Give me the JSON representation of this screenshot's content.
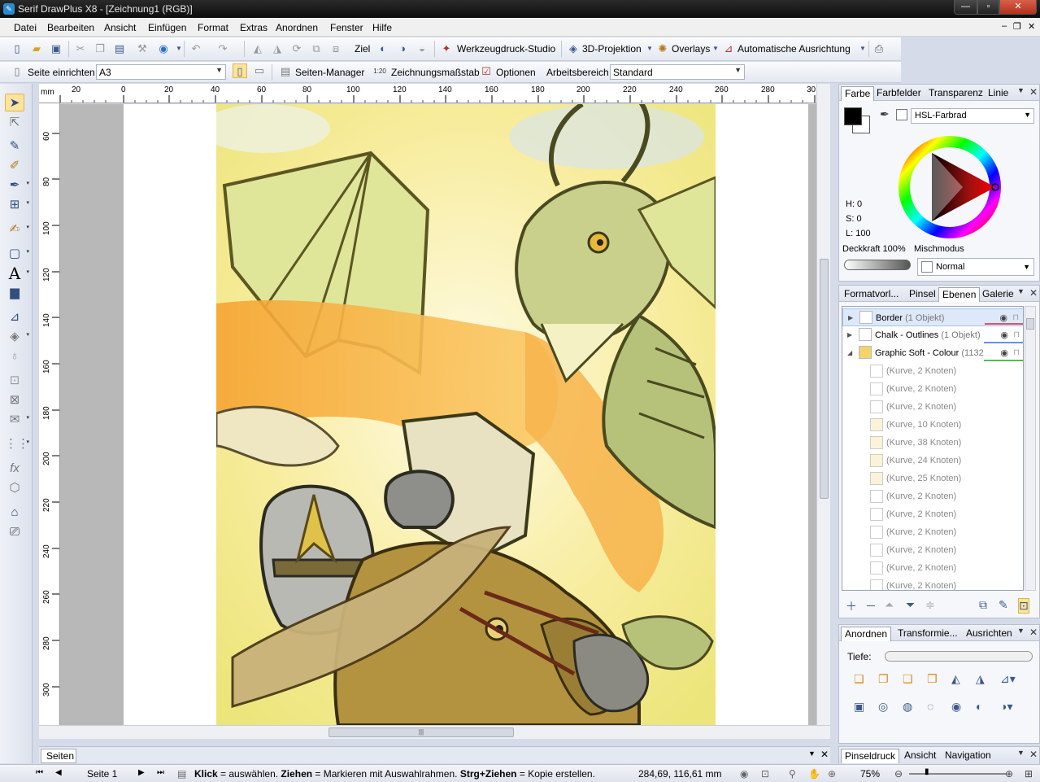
{
  "window": {
    "title": "Serif DrawPlus X8 - [Zeichnung1 (RGB)]",
    "app_icon": "drawplus-icon",
    "minimize": "—",
    "maximize": "▫",
    "close": "✕"
  },
  "menu": {
    "items": [
      "Datei",
      "Bearbeiten",
      "Ansicht",
      "Einfügen",
      "Format",
      "Extras",
      "Anordnen",
      "Fenster",
      "Hilfe"
    ],
    "mdi_min": "–",
    "mdi_restore": "❐",
    "mdi_close": "✕"
  },
  "toolbar1": {
    "ziel_label": "Ziel",
    "werkzeugdruck_label": "Werkzeugdruck-Studio",
    "projektion_label": "3D-Projektion",
    "overlays_label": "Overlays",
    "ausrichtung_label": "Automatische Ausrichtung"
  },
  "toolbar2": {
    "seite_label": "Seite einrichten",
    "page_size_value": "A3",
    "seiten_manager_label": "Seiten-Manager",
    "zeichnungsmassstab_label": "Zeichnungsmaßstab",
    "optionen_label": "Optionen",
    "arbeitsbereich_label": "Arbeitsbereich",
    "arbeitsbereich_value": "Standard"
  },
  "ruler": {
    "unit": "mm",
    "h_labels": [
      "20",
      "0",
      "20",
      "40",
      "60",
      "80",
      "100",
      "120",
      "140",
      "160",
      "180",
      "200",
      "220",
      "240",
      "260",
      "280",
      "30"
    ],
    "v_labels": [
      "60",
      "80",
      "100",
      "120",
      "140",
      "160",
      "180",
      "200",
      "220",
      "240",
      "260",
      "280",
      "300"
    ]
  },
  "color_panel": {
    "tabs": [
      "Farbe",
      "Farbfelder",
      "Transparenz",
      "Linie"
    ],
    "model": "HSL-Farbrad",
    "h": "H: 0",
    "s": "S: 0",
    "l": "L: 100",
    "opacity_label": "Deckkraft",
    "opacity_value": "100%",
    "blend_label": "Mischmodus",
    "blend_value": "Normal"
  },
  "layers_panel": {
    "tabs": [
      "Formatvorl...",
      "Pinsel",
      "Ebenen",
      "Galerie"
    ],
    "layers": [
      {
        "name": "Border",
        "count": "(1 Objekt)",
        "color": "#e0506a"
      },
      {
        "name": "Chalk - Outlines",
        "count": "(1 Objekt)",
        "color": "#6a8fe0"
      },
      {
        "name": "Graphic Soft - Colour",
        "count": "(1132",
        "color": "#4cbf4c"
      }
    ],
    "objects": [
      "(Kurve, 2 Knoten)",
      "(Kurve, 2 Knoten)",
      "(Kurve, 2 Knoten)",
      "(Kurve, 10 Knoten)",
      "(Kurve, 38 Knoten)",
      "(Kurve, 24 Knoten)",
      "(Kurve, 25 Knoten)",
      "(Kurve, 2 Knoten)",
      "(Kurve, 2 Knoten)",
      "(Kurve, 2 Knoten)",
      "(Kurve, 2 Knoten)",
      "(Kurve, 2 Knoten)",
      "(Kurve, 2 Knoten)"
    ]
  },
  "arrange_panel": {
    "tabs": [
      "Anordnen",
      "Transformie...",
      "Ausrichten"
    ],
    "depth_label": "Tiefe:"
  },
  "pages_strip": {
    "tab": "Seiten"
  },
  "bottom_panel": {
    "tabs": [
      "Pinseldruck",
      "Ansicht",
      "Navigation"
    ]
  },
  "status": {
    "page": "Seite 1",
    "hint_b1": "Klick",
    "hint_t1": " = auswählen. ",
    "hint_b2": "Ziehen",
    "hint_t2": " = Markieren mit Auswahlrahmen. ",
    "hint_b3": "Strg+Ziehen",
    "hint_t3": " = Kopie erstellen.",
    "coords": "284,69, 116,61 mm",
    "zoom": "75%"
  }
}
